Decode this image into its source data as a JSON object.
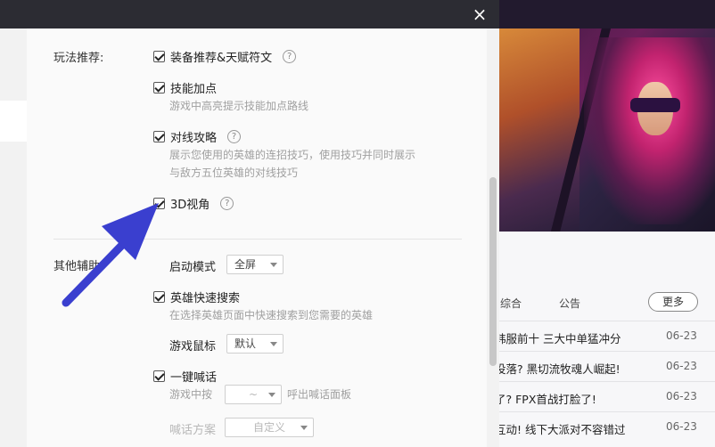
{
  "dialog": {
    "close_glyph": "×",
    "play_section": {
      "label": "玩法推荐:",
      "options": [
        {
          "label": "装备推荐&天赋符文",
          "checked": true,
          "help": "?"
        },
        {
          "label": "技能加点",
          "checked": true,
          "desc": "游戏中高亮提示技能加点路线"
        },
        {
          "label": "对线攻略",
          "checked": true,
          "help": "?",
          "desc_lines": [
            "展示您使用的英雄的连招技巧，使用技巧并同时展示",
            "与敌方五位英雄的对线技巧"
          ]
        },
        {
          "label": "3D视角",
          "checked": true,
          "help": "?"
        }
      ]
    },
    "other_section": {
      "label": "其他辅助:",
      "launch_mode": {
        "label": "启动模式",
        "value": "全屏"
      },
      "hero_search": {
        "label": "英雄快速搜索",
        "checked": true,
        "desc": "在选择英雄页面中快速搜索到您需要的英雄"
      },
      "game_cursor": {
        "label": "游戏鼠标",
        "value": "默认"
      },
      "one_key_shout": {
        "label": "一键喊话",
        "checked": true,
        "desc_prefix": "游戏中按",
        "key_value": "~",
        "desc_suffix": "呼出喊话面板"
      },
      "shout_plan": {
        "label": "喊话方案",
        "value": "自定义"
      }
    }
  },
  "news": {
    "tabs": [
      "综合",
      "公告"
    ],
    "more": "更多",
    "items": [
      {
        "title": "韩服前十 三大中单猛冲分",
        "date": "06-23"
      },
      {
        "title": "没落? 黑切流牧魂人崛起!",
        "date": "06-23"
      },
      {
        "title": "了? FPX首战打脸了!",
        "date": "06-23"
      },
      {
        "title": "互动! 线下大派对不容错过",
        "date": "06-23"
      }
    ]
  },
  "colors": {
    "titlebar": "#2c2c33",
    "arrow": "#3a3fcf",
    "desc_text": "#a0a0a0"
  }
}
